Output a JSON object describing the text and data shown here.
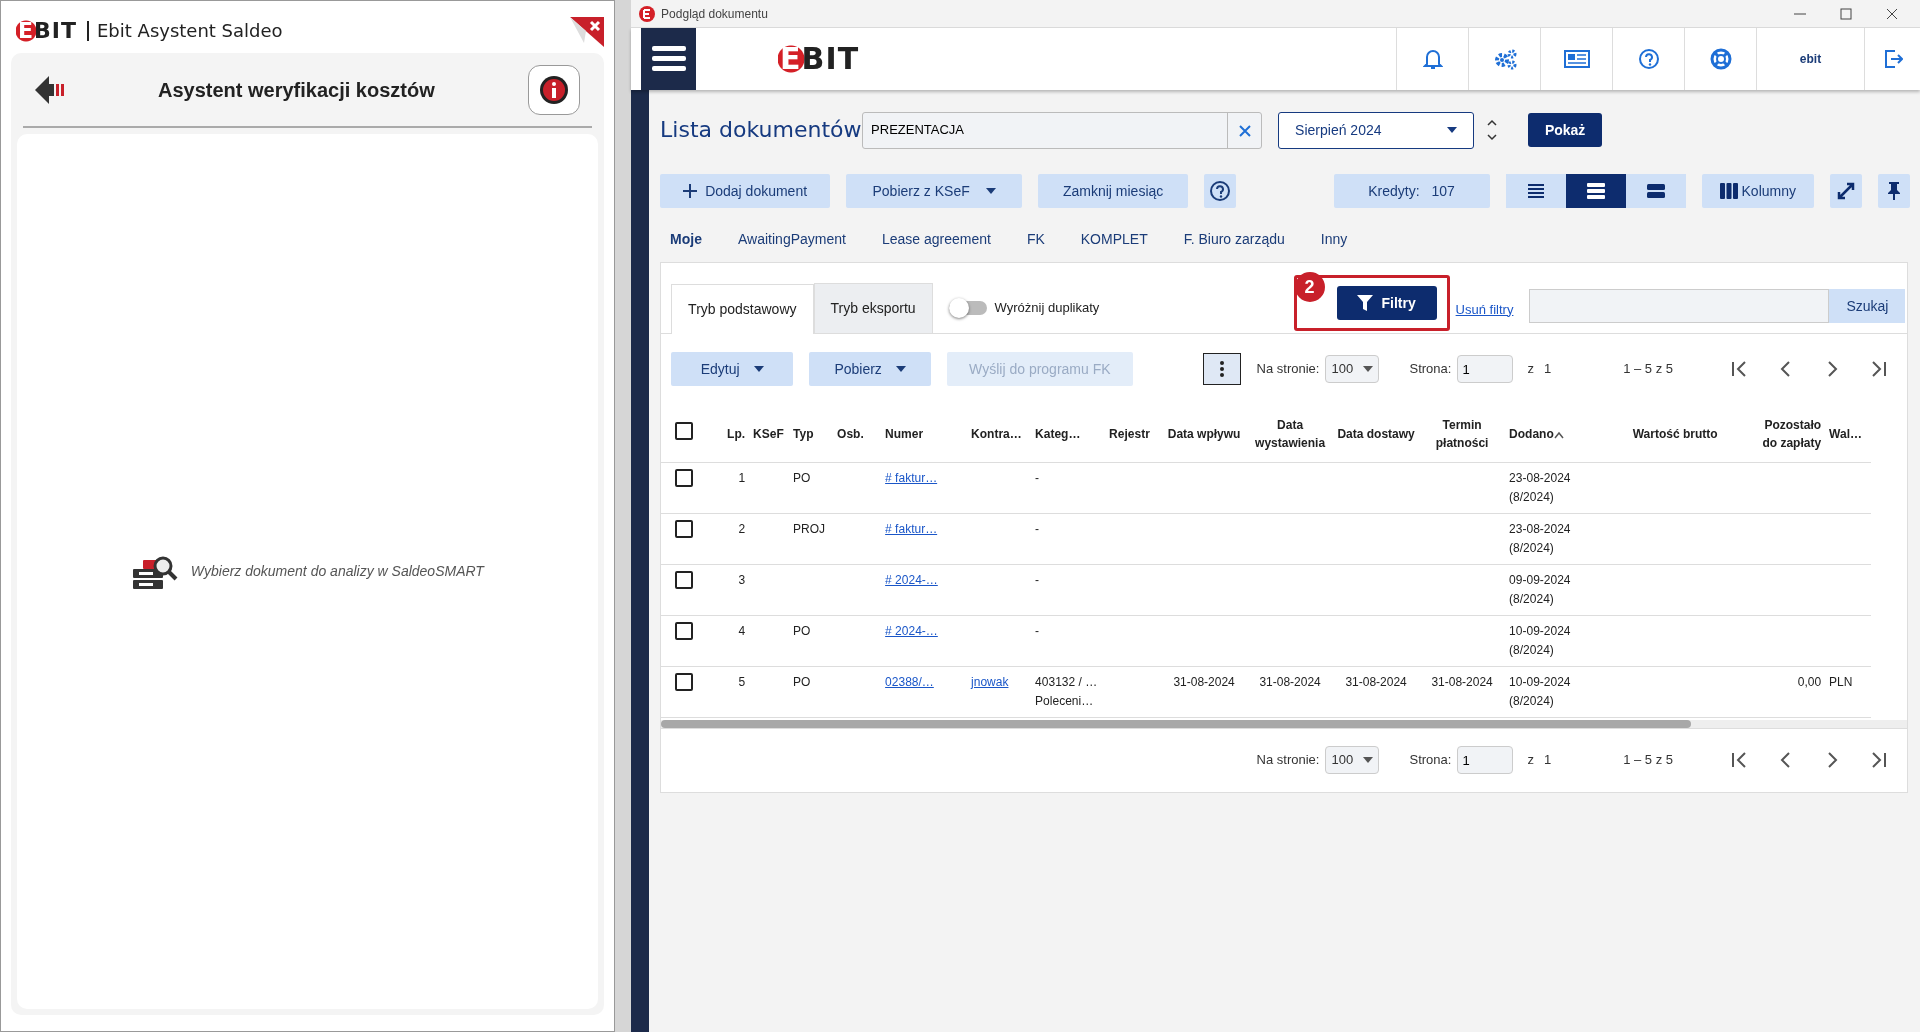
{
  "assistant": {
    "logo": "EBIT",
    "app_title": "Ebit Asystent Saldeo",
    "heading": "Asystent weryfikacji kosztów",
    "empty_message": "Wybierz dokument do analizy w SaldeoSMART"
  },
  "window": {
    "title": "Podgląd dokumentu"
  },
  "header": {
    "logo": "EBIT",
    "user": "ebit"
  },
  "page_title": "Lista dokumentów",
  "search": {
    "value": "PREZENTACJA"
  },
  "period": {
    "value": "Sierpień 2024"
  },
  "show_button": "Pokaż",
  "toolbar": {
    "add": "Dodaj dokument",
    "ksef": "Pobierz z KSeF",
    "close_month": "Zamknij miesiąc",
    "credits_label": "Kredyty:",
    "credits_value": "107",
    "columns": "Kolumny"
  },
  "view_modes": [
    {
      "kind": "compact",
      "selected": false
    },
    {
      "kind": "normal",
      "selected": true
    },
    {
      "kind": "wide",
      "selected": false
    }
  ],
  "categories": [
    {
      "label": "Moje",
      "selected": true
    },
    {
      "label": "AwaitingPayment",
      "selected": false
    },
    {
      "label": "Lease agreement",
      "selected": false
    },
    {
      "label": "FK",
      "selected": false
    },
    {
      "label": "KOMPLET",
      "selected": false
    },
    {
      "label": "F. Biuro zarządu",
      "selected": false
    },
    {
      "label": "Inny",
      "selected": false
    }
  ],
  "mode_tabs": [
    {
      "label": "Tryb podstawowy",
      "selected": true
    },
    {
      "label": "Tryb eksportu",
      "selected": false
    }
  ],
  "duplicates_toggle": {
    "label": "Wyróżnij duplikaty",
    "on": false
  },
  "callout_number": "2",
  "filter_button": "Filtry",
  "clear_filters": "Usuń filtry",
  "search_button": "Szukaj",
  "actions": [
    {
      "label": "Edytuj",
      "dropdown": true,
      "disabled": false
    },
    {
      "label": "Pobierz",
      "dropdown": true,
      "disabled": false
    },
    {
      "label": "Wyślij do programu FK",
      "dropdown": false,
      "disabled": true
    }
  ],
  "pagers": [
    {
      "per_page_label": "Na stronie:",
      "per_page": "100",
      "page_label": "Strona:",
      "page": "1",
      "of": "z",
      "pages": "1",
      "range": "1 – 5 z 5"
    },
    {
      "per_page_label": "Na stronie:",
      "per_page": "100",
      "page_label": "Strona:",
      "page": "1",
      "of": "z",
      "pages": "1",
      "range": "1 – 5 z 5"
    }
  ],
  "table": {
    "select_all_checked": false,
    "columns": [
      {
        "label": "Lp.",
        "sorted": false
      },
      {
        "label": "KSeF",
        "sorted": false
      },
      {
        "label": "Typ",
        "sorted": false
      },
      {
        "label": "Osb.",
        "sorted": false
      },
      {
        "label": "Numer",
        "kind": "link",
        "sorted": false
      },
      {
        "label": "Kontra…",
        "kind": "link",
        "sorted": false
      },
      {
        "label": "Kateg…",
        "sorted": false
      },
      {
        "label": "Rejestr",
        "sorted": false
      },
      {
        "label": "Data wpływu",
        "sorted": false
      },
      {
        "label": "Data wystawienia",
        "sorted": false
      },
      {
        "label": "Data dostawy",
        "sorted": false
      },
      {
        "label": "Termin płatności",
        "sorted": false
      },
      {
        "label": "Dodano",
        "sorted": true
      },
      {
        "label": "Wartość brutto",
        "sorted": false
      },
      {
        "label": "Pozostało do zapłaty",
        "sorted": false
      },
      {
        "label": "Wal…",
        "sorted": false
      }
    ],
    "rows": [
      {
        "checked": false,
        "cells": [
          "1",
          "",
          "PO",
          "",
          "# faktur…",
          "",
          "-",
          "",
          "",
          "",
          "",
          "",
          "23-08-2024\n(8/2024)",
          "",
          "",
          ""
        ]
      },
      {
        "checked": false,
        "cells": [
          "2",
          "",
          "PROJ",
          "",
          "# faktur…",
          "",
          "-",
          "",
          "",
          "",
          "",
          "",
          "23-08-2024\n(8/2024)",
          "",
          "",
          ""
        ]
      },
      {
        "checked": false,
        "cells": [
          "3",
          "",
          "",
          "",
          "# 2024-…",
          "",
          "-",
          "",
          "",
          "",
          "",
          "",
          "09-09-2024\n(8/2024)",
          "",
          "",
          ""
        ]
      },
      {
        "checked": false,
        "cells": [
          "4",
          "",
          "PO",
          "",
          "# 2024-…",
          "",
          "-",
          "",
          "",
          "",
          "",
          "",
          "10-09-2024\n(8/2024)",
          "",
          "",
          ""
        ]
      },
      {
        "checked": false,
        "cells": [
          "5",
          "",
          "PO",
          "",
          "02388/…",
          "jnowak",
          "403132 / …\nPoleceni…",
          "",
          "31-08-2024",
          "31-08-2024",
          "31-08-2024",
          "31-08-2024",
          "10-09-2024\n(8/2024)",
          "",
          "0,00",
          "PLN"
        ]
      }
    ]
  }
}
